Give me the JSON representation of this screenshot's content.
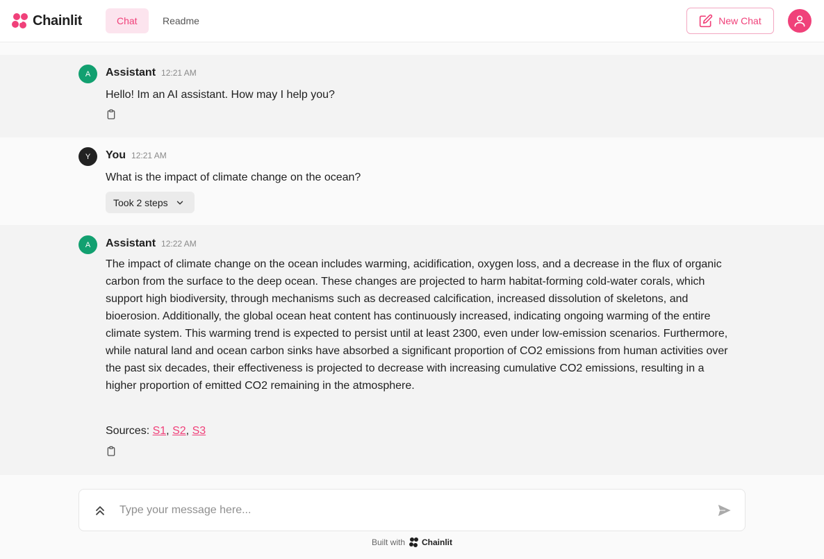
{
  "header": {
    "logo_text": "Chainlit",
    "tabs": [
      {
        "label": "Chat",
        "active": true
      },
      {
        "label": "Readme",
        "active": false
      }
    ],
    "new_chat_label": "New Chat"
  },
  "messages": [
    {
      "role": "assistant",
      "avatar_letter": "A",
      "author": "Assistant",
      "time": "12:21 AM",
      "text": "Hello! Im an AI assistant. How may I help you?"
    },
    {
      "role": "user",
      "avatar_letter": "Y",
      "author": "You",
      "time": "12:21 AM",
      "text": "What is the impact of climate change on the ocean?",
      "steps_label": "Took 2 steps"
    },
    {
      "role": "assistant",
      "avatar_letter": "A",
      "author": "Assistant",
      "time": "12:22 AM",
      "text": "The impact of climate change on the ocean includes warming, acidification, oxygen loss, and a decrease in the flux of organic carbon from the surface to the deep ocean. These changes are projected to harm habitat-forming cold-water corals, which support high biodiversity, through mechanisms such as decreased calcification, increased dissolution of skeletons, and bioerosion. Additionally, the global ocean heat content has continuously increased, indicating ongoing warming of the entire climate system. This warming trend is expected to persist until at least 2300, even under low-emission scenarios. Furthermore, while natural land and ocean carbon sinks have absorbed a significant proportion of CO2 emissions from human activities over the past six decades, their effectiveness is projected to decrease with increasing cumulative CO2 emissions, resulting in a higher proportion of emitted CO2 remaining in the atmosphere.",
      "sources_label": "Sources:",
      "sources": [
        "S1",
        "S2",
        "S3"
      ],
      "separator": ","
    }
  ],
  "composer": {
    "placeholder": "Type your message here..."
  },
  "footer": {
    "built_with": "Built with",
    "logo_text": "Chainlit"
  },
  "colors": {
    "accent": "#f0417a",
    "assistant_avatar": "#12a070",
    "user_avatar": "#222222"
  },
  "icons": [
    "chainlit-logo-icon",
    "edit-icon",
    "user-icon",
    "copy-icon",
    "chevron-down-icon",
    "expand-up-icon",
    "send-icon"
  ]
}
